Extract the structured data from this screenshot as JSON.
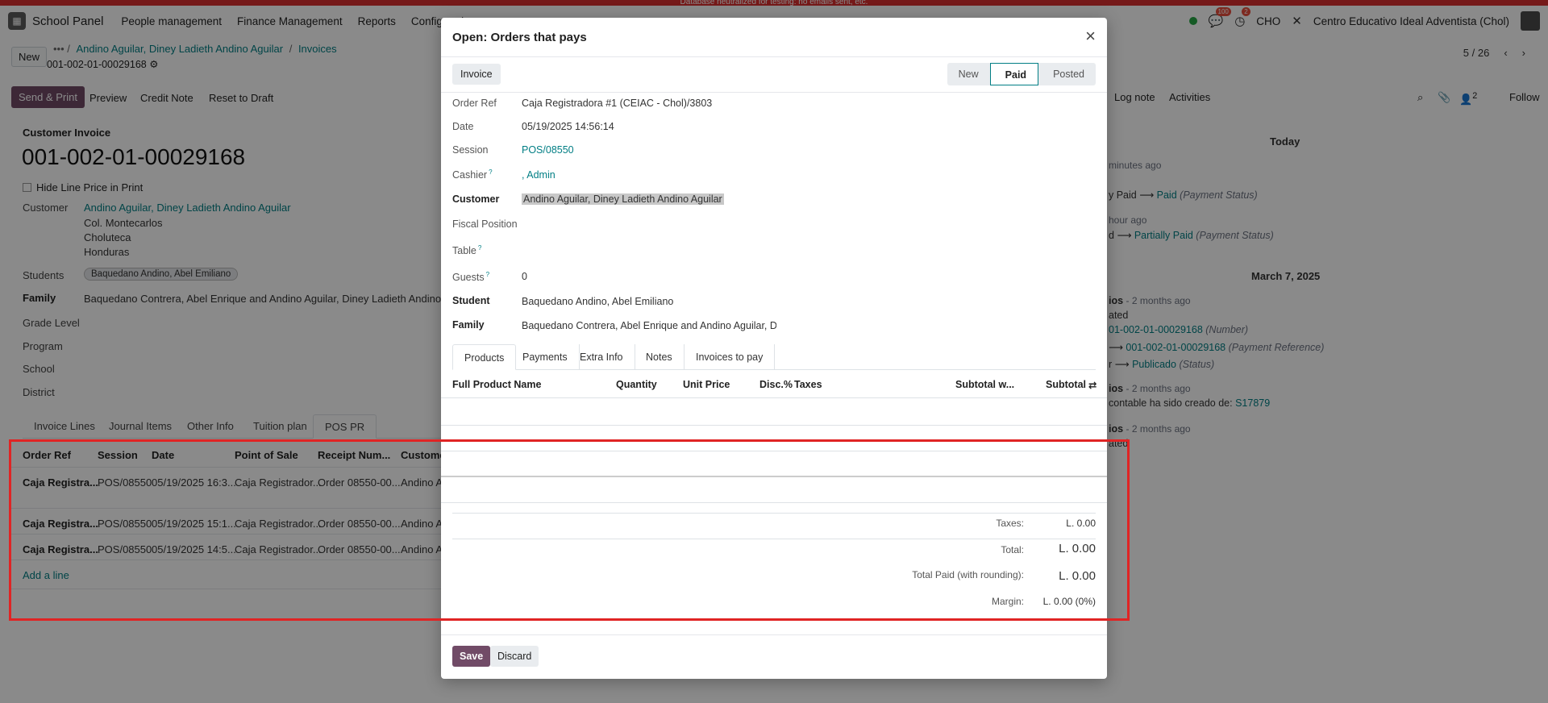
{
  "banner": "Database neutralized for testing: no emails sent, etc.",
  "navbar": {
    "brand": "School Panel",
    "menus": [
      "People management",
      "Finance Management",
      "Reports",
      "Configuration"
    ],
    "messages_count": "100",
    "activities_count": "2",
    "company_code": "CHO",
    "company_name": "Centro Educativo Ideal Adventista (Chol)"
  },
  "breadcrumb": {
    "new_label": "New",
    "parts": [
      "Andino Aguilar, Diney Ladieth Andino Aguilar",
      "Invoices"
    ],
    "record": "001-002-01-00029168",
    "pager": "5 / 26"
  },
  "actions": {
    "send_print": "Send & Print",
    "preview": "Preview",
    "credit_note": "Credit Note",
    "reset": "Reset to Draft"
  },
  "chatter": {
    "log_note": "Log note",
    "activities": "Activities",
    "follower_count": "2",
    "follow": "Follow",
    "today": "Today",
    "t1": "minutes ago",
    "t1_line_a": "y Paid",
    "t1_line_b": "Paid",
    "t1_field": "(Payment Status)",
    "t2": "hour ago",
    "t2_line_a": "d",
    "t2_line_b": "Partially Paid",
    "t2_field": "(Payment Status)",
    "march": "March 7, 2025",
    "e1_author": "ios",
    "e1_time": "- 2 months ago",
    "e1_l1": "ated",
    "e1_l2": "01-002-01-00029168",
    "e1_l2_field": "(Number)",
    "e1_l3": "001-002-01-00029168",
    "e1_l3_field": "(Payment Reference)",
    "e1_l4_a": "r",
    "e1_l4_b": "Publicado",
    "e1_l4_field": "(Status)",
    "e2_author": "ios",
    "e2_time": "- 2 months ago",
    "e2_l1": "contable ha sido creado de:",
    "e2_link": "S17879",
    "e3_author": "ios",
    "e3_time": "- 2 months ago",
    "e3_l1": "ated"
  },
  "form": {
    "type": "Customer Invoice",
    "number": "001-002-01-00029168",
    "hide_price": "Hide Line Price in Print",
    "customer_label": "Customer",
    "customer": "Andino Aguilar, Diney Ladieth Andino Aguilar",
    "addr1": "Col. Montecarlos",
    "addr2": "Choluteca",
    "addr3": "Honduras",
    "students_label": "Students",
    "student_tag": "Baquedano Andino, Abel Emiliano",
    "family_label": "Family",
    "family": "Baquedano Contrera, Abel Enrique and Andino Aguilar, Diney Ladieth Andino Aguilar",
    "grade_label": "Grade Level",
    "program_label": "Program",
    "school_label": "School",
    "district_label": "District",
    "tabs": [
      "Invoice Lines",
      "Journal Items",
      "Other Info",
      "Tuition plan",
      "POS PR"
    ],
    "columns": [
      "Order Ref",
      "Session",
      "Date",
      "Point of Sale",
      "Receipt Num...",
      "Customer"
    ],
    "rows": [
      [
        "Caja Registra...",
        "POS/08550",
        "05/19/2025 16:3...",
        "Caja Registrador...",
        "Order 08550-00...",
        "Andino A"
      ],
      [
        "Caja Registra...",
        "POS/08550",
        "05/19/2025 15:1...",
        "Caja Registrador...",
        "Order 08550-00...",
        "Andino A"
      ],
      [
        "Caja Registra...",
        "POS/08550",
        "05/19/2025 14:5...",
        "Caja Registrador...",
        "Order 08550-00...",
        "Andino A"
      ]
    ],
    "add_line": "Add a line"
  },
  "modal": {
    "title": "Open: Orders that pays",
    "invoice_btn": "Invoice",
    "statuses": [
      "New",
      "Paid",
      "Posted"
    ],
    "active_status": "Paid",
    "fields": {
      "order_ref_label": "Order Ref",
      "order_ref": "Caja Registradora #1 (CEIAC - Chol)/3803",
      "date_label": "Date",
      "date": "05/19/2025 14:56:14",
      "session_label": "Session",
      "session": "POS/08550",
      "cashier_label": "Cashier",
      "cashier": ", Admin",
      "customer_label": "Customer",
      "customer": "Andino Aguilar, Diney Ladieth Andino Aguilar",
      "fiscal_label": "Fiscal Position",
      "table_label": "Table",
      "guests_label": "Guests",
      "guests": "0",
      "student_label": "Student",
      "student": "Baquedano Andino, Abel Emiliano",
      "family_label": "Family",
      "family": "Baquedano Contrera, Abel Enrique and Andino Aguilar, Diney"
    },
    "tabs": [
      "Products",
      "Payments",
      "Extra Info",
      "Notes",
      "Invoices to pay"
    ],
    "columns": [
      "Full Product Name",
      "Quantity",
      "Unit Price",
      "Disc.%",
      "Taxes",
      "Subtotal w...",
      "Subtotal"
    ],
    "taxes_label": "Taxes:",
    "taxes": "L. 0.00",
    "total_label": "Total:",
    "total": "L. 0.00",
    "paid_label": "Total Paid (with rounding):",
    "paid": "L. 0.00",
    "margin_label": "Margin:",
    "margin": "L. 0.00 (0%)",
    "save": "Save",
    "discard": "Discard"
  },
  "colors": {
    "primary": "#714b67",
    "link": "#017e84",
    "annotation": "#e02424"
  }
}
